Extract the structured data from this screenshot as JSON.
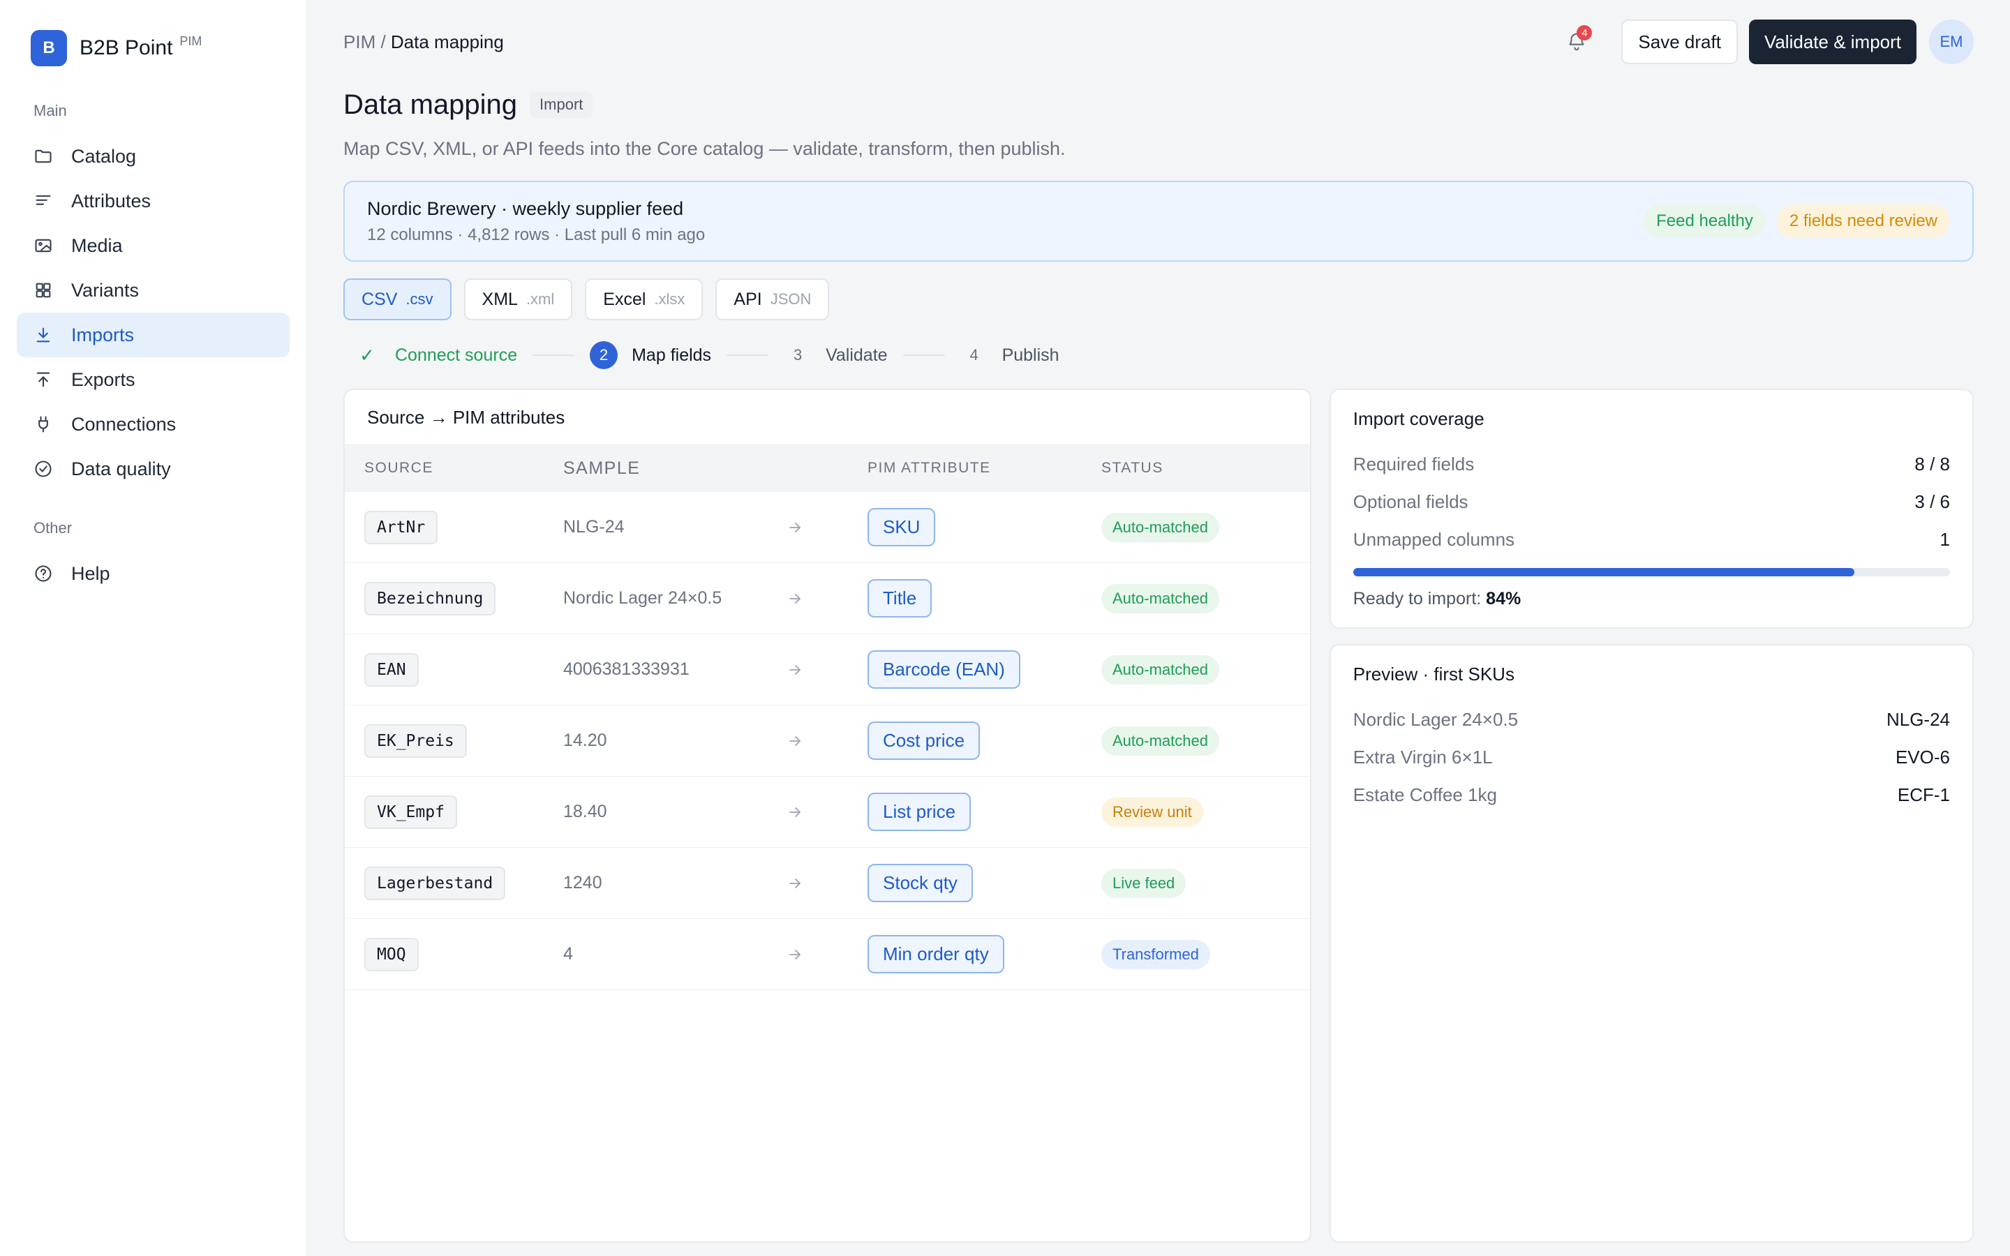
{
  "brand": {
    "logo_letter": "B",
    "name": "B2B Point",
    "tag": "PIM"
  },
  "sidebar": {
    "sections": [
      {
        "label": "Main",
        "items": [
          {
            "label": "Catalog",
            "icon": "folder-icon",
            "active": false
          },
          {
            "label": "Attributes",
            "icon": "lines-icon",
            "active": false
          },
          {
            "label": "Media",
            "icon": "image-icon",
            "active": false
          },
          {
            "label": "Variants",
            "icon": "grid-icon",
            "active": false
          },
          {
            "label": "Imports",
            "icon": "download-icon",
            "active": true
          },
          {
            "label": "Exports",
            "icon": "upload-icon",
            "active": false
          },
          {
            "label": "Connections",
            "icon": "plug-icon",
            "active": false
          },
          {
            "label": "Data quality",
            "icon": "check-circle-icon",
            "active": false
          }
        ]
      },
      {
        "label": "Other",
        "items": [
          {
            "label": "Help",
            "icon": "help-icon",
            "active": false
          }
        ]
      }
    ]
  },
  "header": {
    "breadcrumb_root": "PIM",
    "breadcrumb_sep": " / ",
    "breadcrumb_current": "Data mapping",
    "notification_count": "4",
    "save_label": "Save draft",
    "import_label": "Validate & import",
    "avatar_initials": "EM"
  },
  "page": {
    "title": "Data mapping",
    "title_chip": "Import",
    "subtitle": "Map CSV, XML, or API feeds into the Core catalog — validate, transform, then publish."
  },
  "feed": {
    "name": "Nordic Brewery · weekly supplier feed",
    "meta": "12 columns · 4,812 rows · Last pull 6 min ago",
    "health": "Feed healthy",
    "review": "2 fields need review"
  },
  "formats": [
    {
      "label": "CSV",
      "ext": ".csv",
      "active": true
    },
    {
      "label": "XML",
      "ext": ".xml",
      "active": false
    },
    {
      "label": "Excel",
      "ext": ".xlsx",
      "active": false
    },
    {
      "label": "API",
      "ext": "JSON",
      "active": false
    }
  ],
  "steps": [
    {
      "num": "✓",
      "label": "Connect source",
      "state": "done"
    },
    {
      "num": "2",
      "label": "Map fields",
      "state": "current"
    },
    {
      "num": "3",
      "label": "Validate",
      "state": "todo"
    },
    {
      "num": "4",
      "label": "Publish",
      "state": "todo"
    }
  ],
  "mapping": {
    "title": "Source → PIM attributes",
    "columns": [
      "SOURCE",
      "SAMPLE",
      "PIM ATTRIBUTE",
      "STATUS"
    ],
    "rows": [
      {
        "source": "ArtNr",
        "sample": "NLG-24",
        "attribute": "SKU",
        "status": "Auto-matched",
        "tone": "green"
      },
      {
        "source": "Bezeichnung",
        "sample": "Nordic Lager 24×0.5",
        "attribute": "Title",
        "status": "Auto-matched",
        "tone": "green"
      },
      {
        "source": "EAN",
        "sample": "4006381333931",
        "attribute": "Barcode (EAN)",
        "status": "Auto-matched",
        "tone": "green"
      },
      {
        "source": "EK_Preis",
        "sample": "14.20",
        "attribute": "Cost price",
        "status": "Auto-matched",
        "tone": "green"
      },
      {
        "source": "VK_Empf",
        "sample": "18.40",
        "attribute": "List price",
        "status": "Review unit",
        "tone": "amber"
      },
      {
        "source": "Lagerbestand",
        "sample": "1240",
        "attribute": "Stock qty",
        "status": "Live feed",
        "tone": "green"
      },
      {
        "source": "MOQ",
        "sample": "4",
        "attribute": "Min order qty",
        "status": "Transformed",
        "tone": "blue"
      }
    ]
  },
  "coverage": {
    "title": "Import coverage",
    "items": [
      {
        "label": "Required fields",
        "value": "8 / 8"
      },
      {
        "label": "Optional fields",
        "value": "3 / 6"
      },
      {
        "label": "Unmapped columns",
        "value": "1"
      }
    ],
    "ready_label": "Ready to import:",
    "ready_value": "84%",
    "progress_fraction": 0.84
  },
  "preview": {
    "title": "Preview · first SKUs",
    "items": [
      {
        "name": "Nordic Lager 24×0.5",
        "sku": "NLG-24"
      },
      {
        "name": "Extra Virgin 6×1L",
        "sku": "EVO-6"
      },
      {
        "name": "Estate Coffee 1kg",
        "sku": "ECF-1"
      }
    ]
  },
  "colors": {
    "accent": "#2f63d9",
    "dark": "#1b2433",
    "success": "#1f9d55",
    "warning": "#d48a08"
  }
}
